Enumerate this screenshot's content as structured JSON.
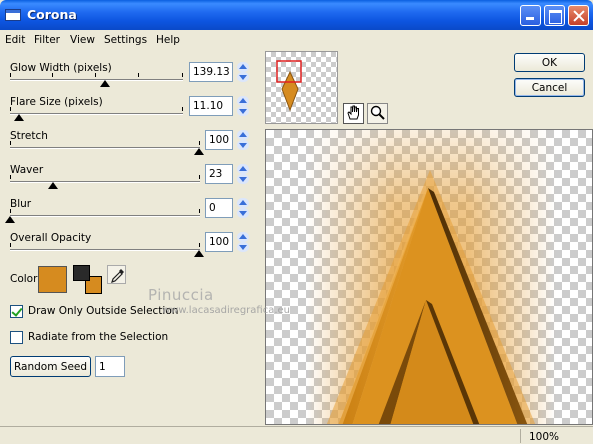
{
  "window": {
    "title": "Corona"
  },
  "menu": [
    "Edit",
    "Filter",
    "View",
    "Settings",
    "Help"
  ],
  "controls": {
    "glow_width": {
      "label": "Glow Width (pixels)",
      "value": "139.13",
      "level": 0.55
    },
    "flare_size": {
      "label": "Flare Size (pixels)",
      "value": "11.10",
      "level": 0.05
    },
    "stretch": {
      "label": "Stretch",
      "value": "100",
      "level": 1.0
    },
    "waver": {
      "label": "Waver",
      "value": "23",
      "level": 0.23
    },
    "blur": {
      "label": "Blur",
      "value": "0",
      "level": 0.0
    },
    "overall_opacity": {
      "label": "Overall Opacity",
      "value": "100",
      "level": 1.0
    }
  },
  "color": {
    "label": "Color",
    "main": "#d68b1f",
    "foreground": "#2a2a2a",
    "background": "#d68b1f"
  },
  "options": {
    "outside_selection": {
      "label": "Draw Only Outside Selection",
      "checked": true
    },
    "radiate": {
      "label": "Radiate from the Selection",
      "checked": false
    }
  },
  "seed": {
    "button": "Random Seed",
    "value": "1"
  },
  "buttons": {
    "ok": "OK",
    "cancel": "Cancel"
  },
  "watermark": {
    "line1": "Pinuccia",
    "line2": "www.lacasadiregrafica.eu"
  },
  "status": {
    "zoom": "100%"
  },
  "icons": {
    "pan_tool": "hand-icon",
    "zoom_tool": "magnifier-icon",
    "picker": "eyedropper-icon"
  }
}
